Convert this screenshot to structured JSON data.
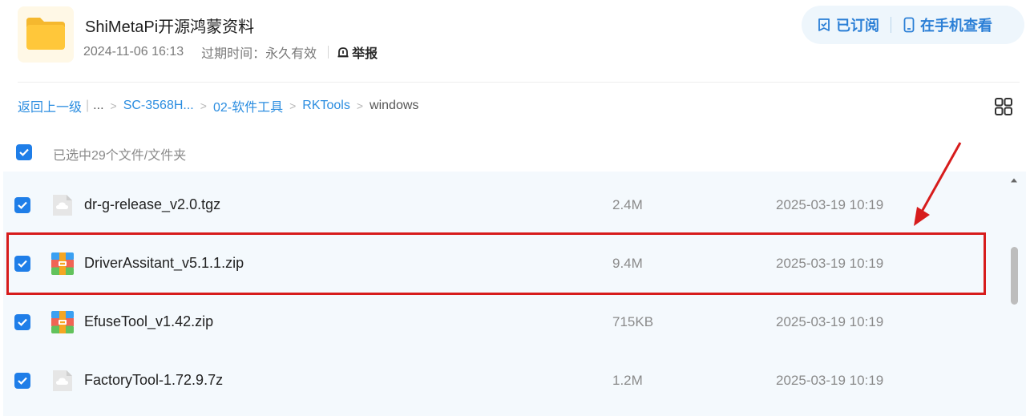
{
  "header": {
    "title": "ShiMetaPi开源鸿蒙资料",
    "date": "2024-11-06 16:13",
    "expire": "过期时间：永久有效",
    "report_label": "举报"
  },
  "actions": {
    "subscribed_label": "已订阅",
    "phone_view_label": "在手机查看"
  },
  "breadcrumb": {
    "back_label": "返回上一级",
    "separator": "|",
    "ellipsis": "...",
    "items": [
      "SC-3568H...",
      "02-软件工具",
      "RKTools"
    ],
    "current": "windows",
    "arrow": ">"
  },
  "selection": {
    "text": "已选中29个文件/文件夹"
  },
  "files": [
    {
      "name": "dr-g-release_v2.0.tgz",
      "size": "2.4M",
      "date": "2025-03-19 10:19",
      "icon": "cloud-file-icon",
      "checked": true
    },
    {
      "name": "DriverAssitant_v5.1.1.zip",
      "size": "9.4M",
      "date": "2025-03-19 10:19",
      "icon": "zip-archive-icon",
      "checked": true
    },
    {
      "name": "EfuseTool_v1.42.zip",
      "size": "715KB",
      "date": "2025-03-19 10:19",
      "icon": "zip-archive-icon",
      "checked": true
    },
    {
      "name": "FactoryTool-1.72.9.7z",
      "size": "1.2M",
      "date": "2025-03-19 10:19",
      "icon": "cloud-file-icon",
      "checked": true
    }
  ],
  "colors": {
    "accent": "#1f7ee8",
    "link": "#2b8de0",
    "highlight": "#d71c1c",
    "list_bg": "#f4f9fd"
  }
}
